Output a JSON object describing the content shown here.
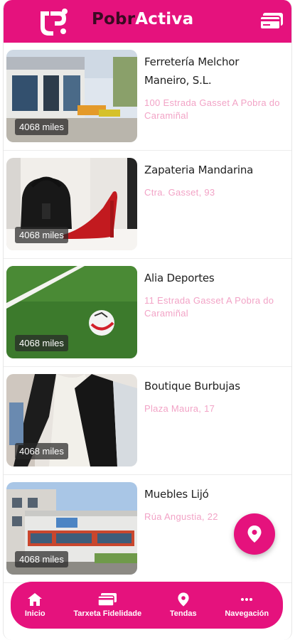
{
  "header": {
    "brand_part1": "Pobr",
    "brand_part2": "Activa"
  },
  "stores": [
    {
      "name": "Ferretería Melchor Maneiro, S.L.",
      "address": "100 Estrada Gasset A Pobra do Caramiñal",
      "distance": "4068 miles"
    },
    {
      "name": "Zapateria Mandarina",
      "address": "Ctra. Gasset, 93",
      "distance": "4068 miles"
    },
    {
      "name": "Alia Deportes",
      "address": "11 Estrada Gasset A Pobra do Caramiñal",
      "distance": "4068 miles"
    },
    {
      "name": "Boutique Burbujas",
      "address": "Plaza Maura, 17",
      "distance": "4068 miles"
    },
    {
      "name": "Muebles Lijó",
      "address": "Rúa Angustia, 22",
      "distance": "4068 miles"
    }
  ],
  "nav": [
    {
      "label": "Inicio",
      "icon": "home-icon"
    },
    {
      "label": "Tarxeta Fidelidade",
      "icon": "loyalty-card-icon"
    },
    {
      "label": "Tendas",
      "icon": "map-pin-icon"
    },
    {
      "label": "Navegación",
      "icon": "more-icon"
    }
  ],
  "colors": {
    "accent": "#e5127d",
    "address": "#f2a3c6",
    "brand_dark": "#3a0a22"
  }
}
